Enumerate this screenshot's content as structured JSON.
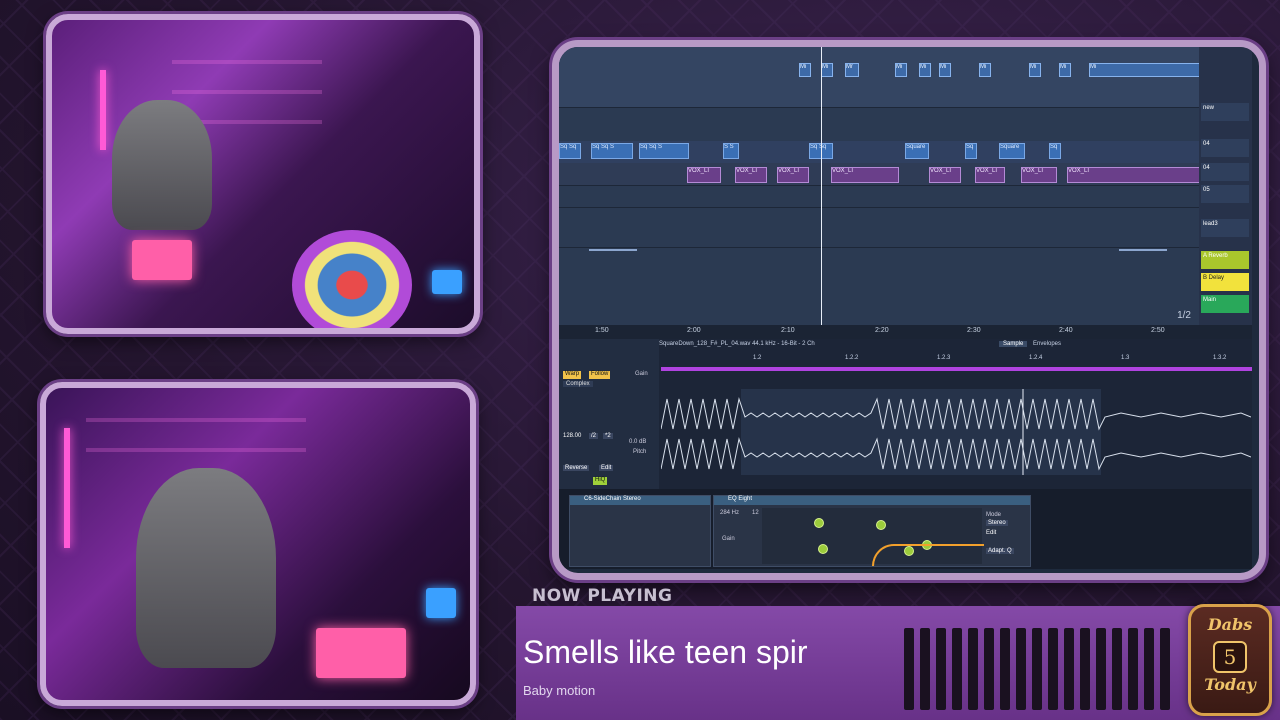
{
  "overlay": {
    "now_playing_label": "NOW PLAYING",
    "song_title": "Smells like teen spir",
    "artist": "Baby motion",
    "logo": {
      "line1": "Dabs",
      "number": "5",
      "line2": "Today"
    }
  },
  "daw": {
    "arrangement": {
      "clips_row1": [
        "Mi",
        "Mi",
        "Mr",
        "Mi",
        "Mi",
        "Mi",
        "Mi",
        "Mi",
        "Mi",
        "Mi"
      ],
      "clips_row2": [
        "Sq Sq",
        "Sq Sq S",
        "Sq Sq S",
        "S S",
        "Sq Sq",
        "Square",
        "Sq",
        "Square",
        "Sq"
      ],
      "clips_row3": [
        "VOX_LI",
        "VOX_LI",
        "VOX_LI",
        "VOX_LI",
        "VOX_LI",
        "VOX_LI",
        "VOX_LI",
        "VOX_LI"
      ],
      "page_indicator": "1/2"
    },
    "tracks": [
      {
        "label": "new",
        "color": "#2f3f5c"
      },
      {
        "label": "04",
        "color": "#2f3f5c"
      },
      {
        "label": "04",
        "color": "#2f3f5c"
      },
      {
        "label": "05",
        "color": "#2f3f5c"
      },
      {
        "label": "lead3",
        "color": "#2f3f5c"
      },
      {
        "label": "A Reverb",
        "color": "#a9c72c"
      },
      {
        "label": "B Delay",
        "color": "#f2e23c"
      },
      {
        "label": "Main",
        "color": "#29a85a"
      }
    ],
    "ruler": [
      "1:50",
      "2:00",
      "2:10",
      "2:20",
      "2:30",
      "2:40",
      "2:50"
    ],
    "clip_detail": {
      "file": "SquareDown_128_F#_PL_04.wav  44.1 kHz - 16-Bit - 2 Ch",
      "tab_sample": "Sample",
      "tab_envelopes": "Envelopes",
      "warp": "Warp",
      "follow": "Follow",
      "mode": "Complex",
      "gain_label": "Gain",
      "gain_value": "0.0 dB",
      "bpm": "128.00",
      "div": "/2",
      "mul": "*2",
      "reverse": "Reverse",
      "edit": "Edit",
      "hiq": "HiQ",
      "pitch_label": "Pitch",
      "markers": [
        "1.2",
        "1.2.2",
        "1.2.3",
        "1.2.4",
        "1.3",
        "1.3.2"
      ]
    },
    "devices": {
      "compressor": "C6-SideChain Stereo",
      "eq": "EQ Eight",
      "eq_freq": "284 Hz",
      "eq_gain": "Gain",
      "eq_db": "12",
      "eq_mode": "Mode",
      "eq_mode_value": "Stereo",
      "eq_edit": "Edit",
      "eq_adapt": "Adapt. Q"
    }
  }
}
